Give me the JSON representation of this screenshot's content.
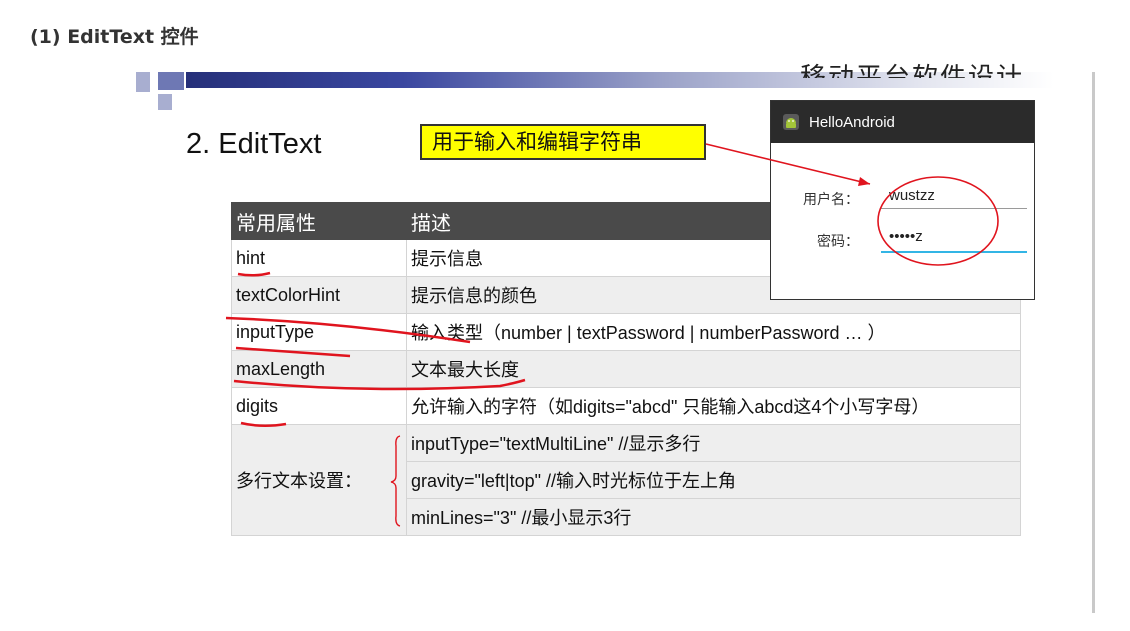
{
  "heading": "(1) EditText 控件",
  "slide": {
    "header_text": "移动平台软件设计",
    "title": "2. EditText",
    "callout": "用于输入和编辑字符串"
  },
  "table": {
    "headers": [
      "常用属性",
      "描述"
    ],
    "rows": [
      {
        "attr": "hint",
        "desc": "提示信息"
      },
      {
        "attr": "textColorHint",
        "desc": "提示信息的颜色"
      },
      {
        "attr": "inputType",
        "desc": "输入类型（number | textPassword | numberPassword … ）"
      },
      {
        "attr": "maxLength",
        "desc": "文本最大长度"
      },
      {
        "attr": "digits",
        "desc": "允许输入的字符（如digits=\"abcd\" 只能输入abcd这4个小写字母）"
      }
    ],
    "multiline": {
      "label": "多行文本设置：",
      "items": [
        "inputType=\"textMultiLine\"   //显示多行",
        "gravity=\"left|top\"  //输入时光标位于左上角",
        "minLines=\"3\"    //最小显示3行"
      ]
    }
  },
  "phone": {
    "app_title": "HelloAndroid",
    "user_label": "用户名：",
    "user_value": "wustzz",
    "pwd_label": "密码：",
    "pwd_value": "•••••z"
  },
  "colors": {
    "callout_bg": "#ffff00",
    "annotation_red": "#e0141e",
    "table_header_bg": "#4a4a4a",
    "android_green": "#a4c639",
    "focus_blue": "#33b5e5"
  },
  "icons": {
    "app_icon": "android-icon"
  }
}
